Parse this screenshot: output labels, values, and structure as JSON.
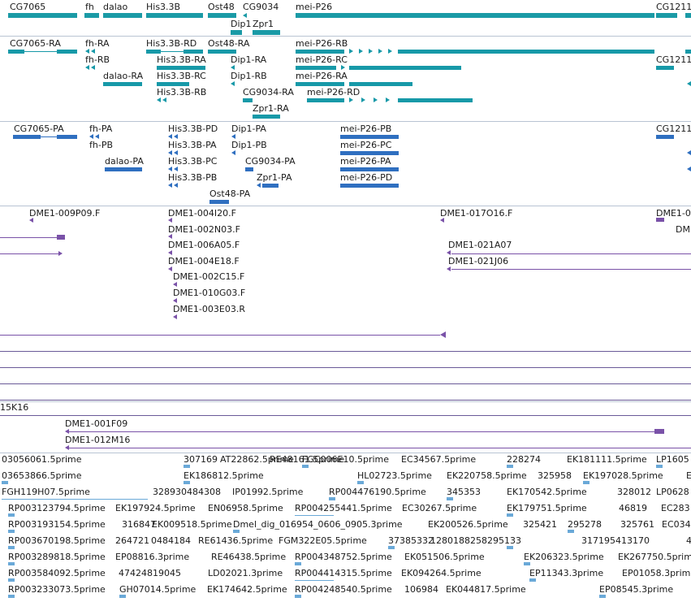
{
  "colors": {
    "gene": "#1a9aa6",
    "transcript": "#1799a8",
    "protein": "#2f6fc0",
    "clone": "#7a52a8",
    "est": "#6aa9d8",
    "divider": "#b9c4d3"
  },
  "genes": [
    {
      "label": "CG7065"
    },
    {
      "label": "fh"
    },
    {
      "label": "dalao"
    },
    {
      "label": "His3.3B"
    },
    {
      "label": "Ost48"
    },
    {
      "label": "CG9034"
    },
    {
      "label": "mei-P26"
    },
    {
      "label": "CG1211"
    },
    {
      "label": "Dip1"
    },
    {
      "label": "Zpr1"
    }
  ],
  "transcripts": [
    {
      "label": "CG7065-RA"
    },
    {
      "label": "fh-RA"
    },
    {
      "label": "fh-RB"
    },
    {
      "label": "dalao-RA"
    },
    {
      "label": "His3.3B-RD"
    },
    {
      "label": "His3.3B-RA"
    },
    {
      "label": "His3.3B-RC"
    },
    {
      "label": "His3.3B-RB"
    },
    {
      "label": "Ost48-RA"
    },
    {
      "label": "Dip1-RA"
    },
    {
      "label": "Dip1-RB"
    },
    {
      "label": "CG9034-RA"
    },
    {
      "label": "Zpr1-RA"
    },
    {
      "label": "mei-P26-RB"
    },
    {
      "label": "mei-P26-RC"
    },
    {
      "label": "mei-P26-RA"
    },
    {
      "label": "mei-P26-RD"
    },
    {
      "label": "CG1211"
    }
  ],
  "proteins": [
    {
      "label": "CG7065-PA"
    },
    {
      "label": "fh-PA"
    },
    {
      "label": "fh-PB"
    },
    {
      "label": "dalao-PA"
    },
    {
      "label": "His3.3B-PD"
    },
    {
      "label": "His3.3B-PA"
    },
    {
      "label": "His3.3B-PC"
    },
    {
      "label": "His3.3B-PB"
    },
    {
      "label": "Ost48-PA"
    },
    {
      "label": "Dip1-PA"
    },
    {
      "label": "Dip1-PB"
    },
    {
      "label": "CG9034-PA"
    },
    {
      "label": "Zpr1-PA"
    },
    {
      "label": "mei-P26-PB"
    },
    {
      "label": "mei-P26-PC"
    },
    {
      "label": "mei-P26-PA"
    },
    {
      "label": "mei-P26-PD"
    },
    {
      "label": "CG1211"
    }
  ],
  "clones": [
    {
      "label": "DME1-009P09.F"
    },
    {
      "label": "DME1-004I20.F"
    },
    {
      "label": "DME1-002N03.F"
    },
    {
      "label": "DME1-006A05.F"
    },
    {
      "label": "DME1-004E18.F"
    },
    {
      "label": "DME1-002C15.F"
    },
    {
      "label": "DME1-010G03.F"
    },
    {
      "label": "DME1-003E03.R"
    },
    {
      "label": "DME1-017O16.F"
    },
    {
      "label": "DME1-021A07"
    },
    {
      "label": "DME1-021J06"
    },
    {
      "label": "DME1-0"
    },
    {
      "label": "DM"
    }
  ],
  "bac_track": {
    "label1": "15K16",
    "label2": "DME1-001F09",
    "label3": "DME1-012M16"
  },
  "est_rows": [
    [
      "03056061.5prime",
      "307169",
      "AT22862.5prime",
      "RE48161.5prime",
      "FGC006E10.5prime",
      "EC34567.5prime",
      "228274",
      "EK181111.5prime",
      "LP1605"
    ],
    [
      "03653866.5prime",
      "EK186812.5prime",
      "HL02723.5prime",
      "EK220758.5prime",
      "325958",
      "EK197028.5prime",
      "E"
    ],
    [
      "FGH119H07.5prime",
      "328930484308",
      "IP01992.5prime",
      "RP004476190.5prime",
      "345353",
      "EK170542.5prime",
      "328012",
      "LP0628"
    ],
    [
      "RP003123794.5prime",
      "EK197924.5prime",
      "EN06958.5prime",
      "RP004255441.5prime",
      "EC30267.5prime",
      "EK179751.5prime",
      "46819",
      "EC283"
    ],
    [
      "RP003193154.5prime",
      "316847",
      "EK009518.5prime",
      "Dmel_dig_016954_0606_0905.3prime",
      "EK200526.5prime",
      "325421",
      "295278",
      "325761",
      "EC034"
    ],
    [
      "RP003670198.5prime",
      "264721",
      "0484184",
      "RE61436.5prime",
      "FGM322E05.5prime",
      "37385332",
      "1280188",
      "258295133",
      "317195413170",
      "4"
    ],
    [
      "RP003289818.5prime",
      "EP08816.3prime",
      "RE46438.5prime",
      "RP004348752.5prime",
      "EK051506.5prime",
      "EK206323.5prime",
      "EK267750.5prime"
    ],
    [
      "RP003584092.5prime",
      "47424819045",
      "LD02021.3prime",
      "RP004414315.5prime",
      "EK094264.5prime",
      "EP11343.3prime",
      "EP01058.3prime"
    ],
    [
      "RP003233073.5prime",
      "GH07014.5prime",
      "EK174642.5prime",
      "RP004248540.5prime",
      "106984",
      "EK044817.5prime",
      "EP08545.3prime"
    ]
  ]
}
